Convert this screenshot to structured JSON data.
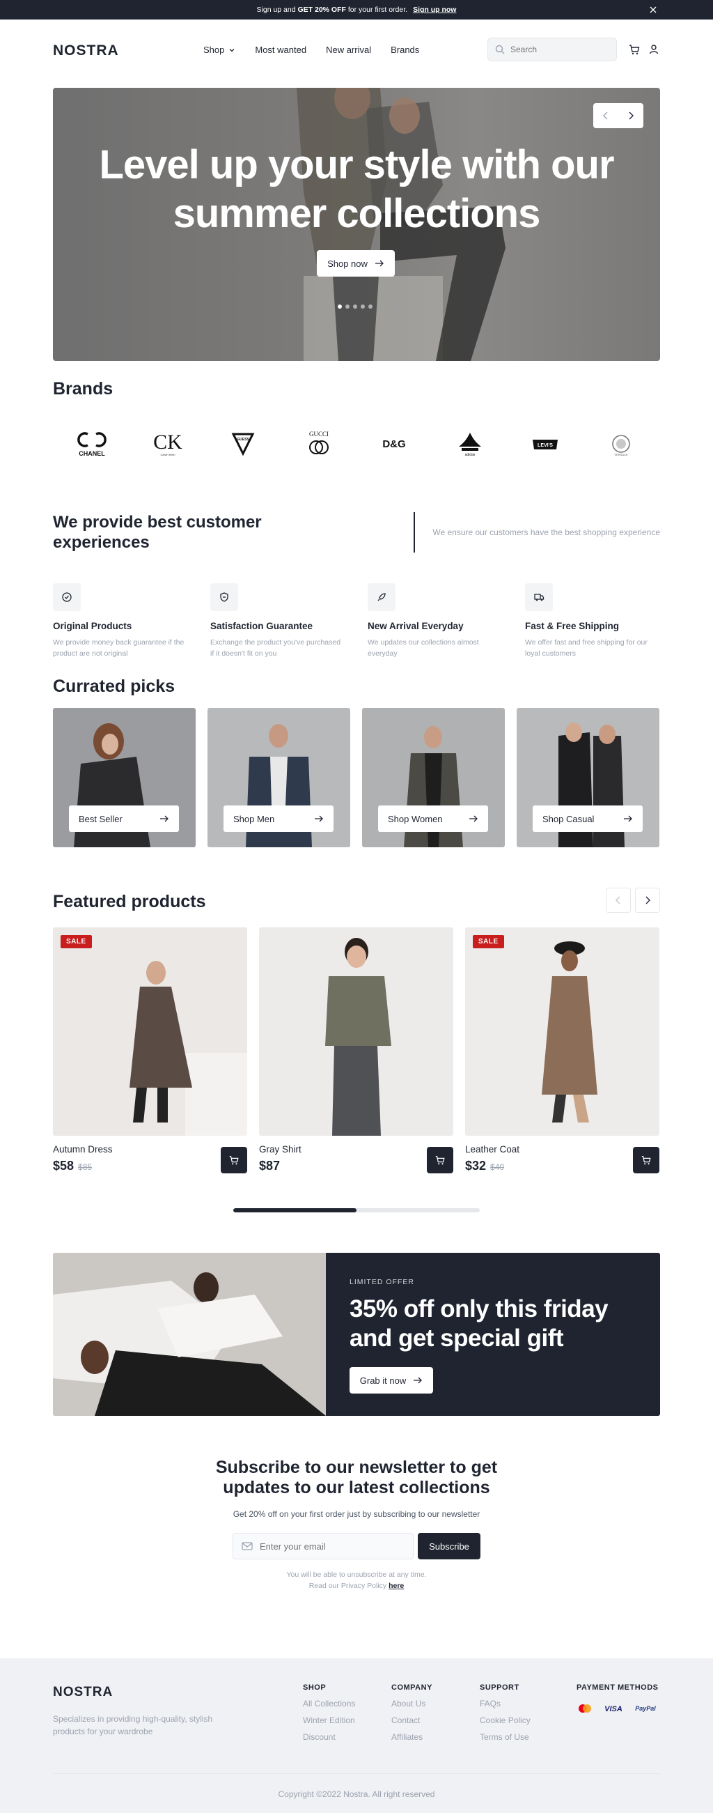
{
  "promo": {
    "text_before": "Sign up and ",
    "highlight": "GET 20% OFF",
    "text_after": " for your first order.",
    "link": "Sign up now"
  },
  "header": {
    "logo": "NOSTRA",
    "nav": [
      "Shop",
      "Most wanted",
      "New arrival",
      "Brands"
    ],
    "search_placeholder": "Search"
  },
  "hero": {
    "title": "Level up your style with our summer collections",
    "cta": "Shop now",
    "slides": 5,
    "active_slide": 1
  },
  "brands": {
    "title": "Brands",
    "items": [
      "CHANEL",
      "Calvin Klein",
      "GUESS",
      "GUCCI",
      "D&G",
      "adidas",
      "Levi's",
      "VERSACE"
    ]
  },
  "experience": {
    "title": "We provide best customer experiences",
    "tagline": "We ensure our customers have the best shopping experience",
    "features": [
      {
        "title": "Original Products",
        "desc": "We provide money back guarantee if the product are not original",
        "icon": "badge-check-icon"
      },
      {
        "title": "Satisfaction Guarantee",
        "desc": "Exchange the product you've purchased if it doesn't fit on you",
        "icon": "shield-icon"
      },
      {
        "title": "New Arrival Everyday",
        "desc": "We updates our collections almost everyday",
        "icon": "rocket-icon"
      },
      {
        "title": "Fast & Free Shipping",
        "desc": "We offer fast and free shipping for our loyal customers",
        "icon": "truck-icon"
      }
    ]
  },
  "curated": {
    "title": "Currated picks",
    "items": [
      "Best Seller",
      "Shop Men",
      "Shop Women",
      "Shop Casual"
    ]
  },
  "featured": {
    "title": "Featured products",
    "products": [
      {
        "name": "Autumn Dress",
        "price": "$58",
        "old_price": "$85",
        "sale": "SALE"
      },
      {
        "name": "Gray Shirt",
        "price": "$87",
        "old_price": "",
        "sale": ""
      },
      {
        "name": "Leather Coat",
        "price": "$32",
        "old_price": "$40",
        "sale": "SALE"
      }
    ],
    "scroll_progress": 0.5
  },
  "offer": {
    "label": "LIMITED OFFER",
    "title": "35% off only this friday and get special gift",
    "cta": "Grab it now"
  },
  "newsletter": {
    "title": "Subscribe to our newsletter to get updates to our latest collections",
    "subtitle": "Get 20% off on your first order just by subscribing to our newsletter",
    "placeholder": "Enter your email",
    "button": "Subscribe",
    "note_line1": "You will be able to unsubscribe at any time.",
    "note_line2": "Read our Privacy Policy ",
    "note_link": "here"
  },
  "footer": {
    "logo": "NOSTRA",
    "desc": "Specializes in providing high-quality, stylish products for your wardrobe",
    "columns": [
      {
        "title": "SHOP",
        "links": [
          "All Collections",
          "Winter Edition",
          "Discount"
        ]
      },
      {
        "title": "COMPANY",
        "links": [
          "About Us",
          "Contact",
          "Affiliates"
        ]
      },
      {
        "title": "SUPPORT",
        "links": [
          "FAQs",
          "Cookie Policy",
          "Terms of Use"
        ]
      }
    ],
    "payment_title": "PAYMENT METHODS",
    "payments": [
      "Mastercard",
      "VISA",
      "PayPal"
    ],
    "copyright": "Copyright ©2022 Nostra. All right reserved"
  }
}
